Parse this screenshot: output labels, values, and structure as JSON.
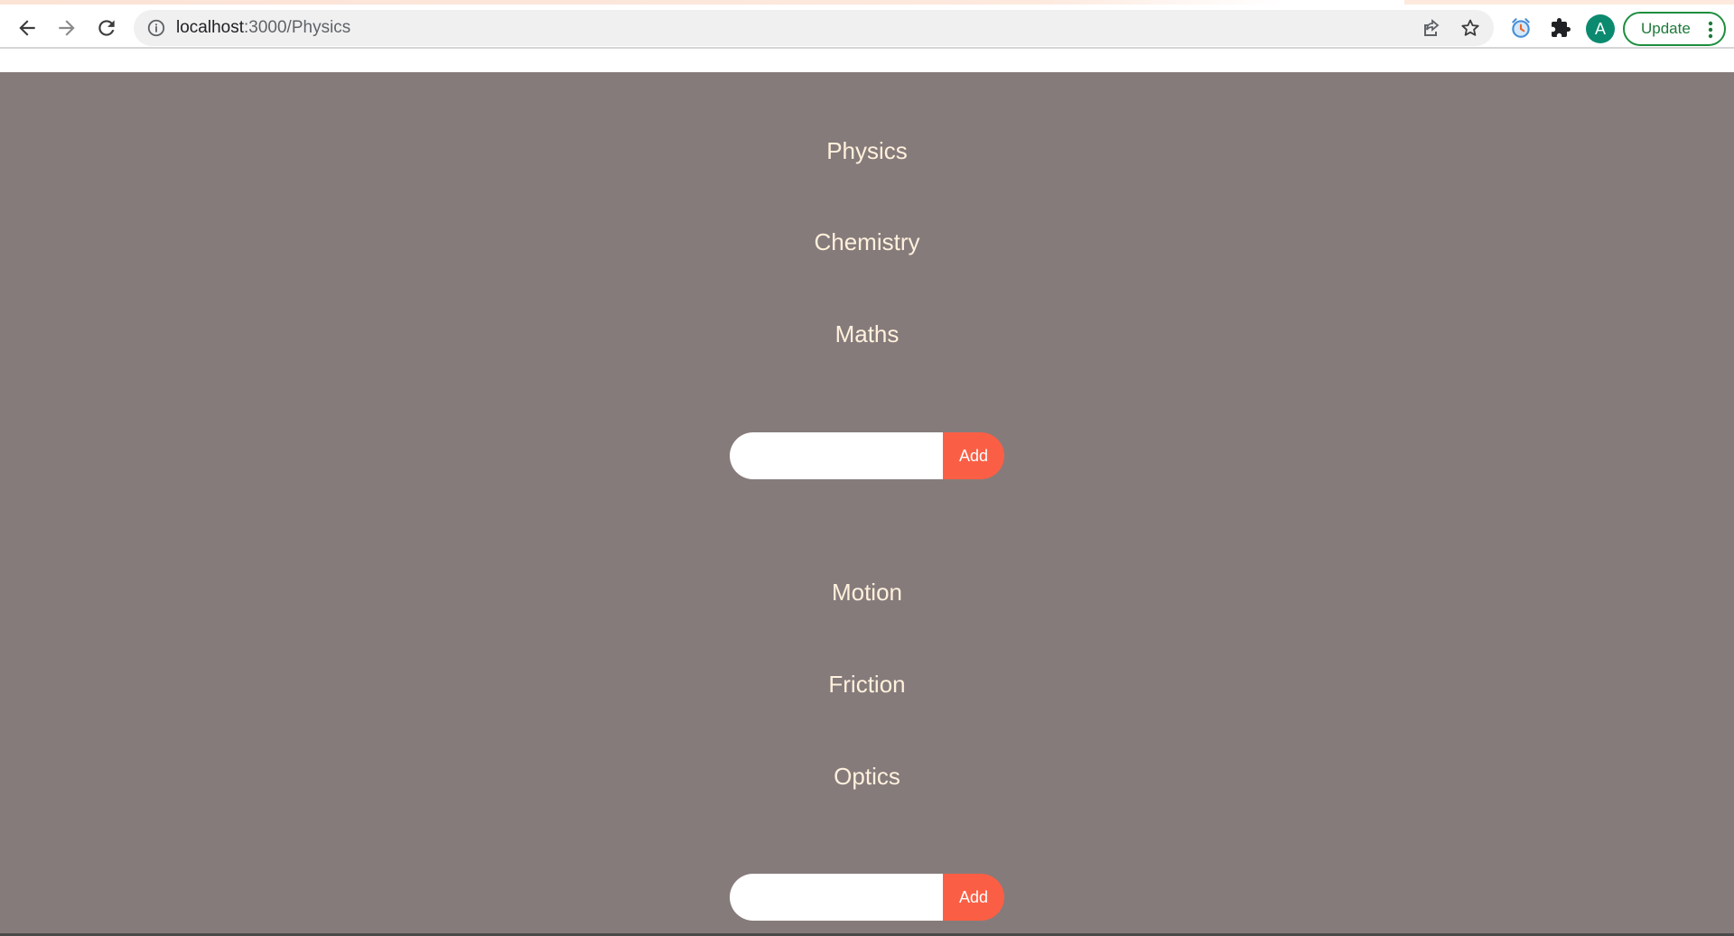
{
  "browser": {
    "url_host": "localhost",
    "url_path": ":3000/Physics",
    "profile_initial": "A",
    "update_label": "Update",
    "icons": {
      "back": "arrow-back-icon",
      "forward": "arrow-forward-icon",
      "reload": "reload-icon",
      "site_info": "info-icon",
      "share": "share-icon",
      "bookmark": "star-icon",
      "extension_alarm": "alarm-clock-icon",
      "extensions": "puzzle-icon",
      "menu": "kebab-menu-icon"
    },
    "colors": {
      "profile": "#0b8a6f",
      "update_border": "#1e8e3e"
    }
  },
  "page": {
    "background": "#867b7b",
    "text_color": "#fff1dc",
    "accent": "#fa5f45",
    "categories": [
      "Physics",
      "Chemistry",
      "Maths"
    ],
    "category_form": {
      "input_value": "",
      "add_label": "Add"
    },
    "topics": [
      "Motion",
      "Friction",
      "Optics"
    ],
    "topic_form": {
      "input_value": "",
      "add_label": "Add"
    }
  }
}
